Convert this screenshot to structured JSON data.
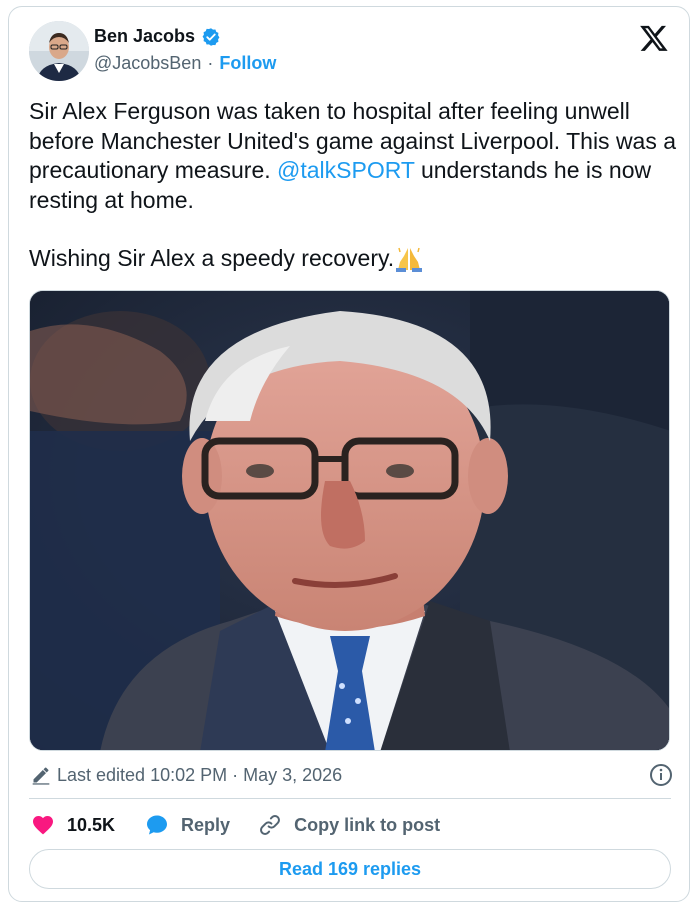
{
  "author": {
    "name": "Ben Jacobs",
    "handle": "@JacobsBen",
    "separator": "·",
    "follow_label": "Follow"
  },
  "post": {
    "text_before_mention": "Sir Alex Ferguson was taken to hospital after feeling unwell before Manchester United's game against Liverpool. This was a precautionary measure. ",
    "mention": "@talkSPORT",
    "text_after_mention": " understands he is now resting at home.",
    "second_paragraph": "Wishing Sir Alex a speedy recovery.",
    "emoji": "folded-hands"
  },
  "meta": {
    "edited_label": "Last edited 10:02 PM · May 3, 2026"
  },
  "actions": {
    "like_count": "10.5K",
    "reply_label": "Reply",
    "copy_label": "Copy link to post"
  },
  "read_replies_label": "Read 169 replies",
  "colors": {
    "accent": "#1d9bf0",
    "like": "#f91880",
    "text": "#0f1419",
    "muted": "#536471",
    "border": "#cfd9de"
  },
  "icons": [
    "verified-badge-icon",
    "x-logo-icon",
    "pencil-icon",
    "info-icon",
    "heart-icon",
    "reply-bubble-icon",
    "link-icon",
    "folded-hands-emoji"
  ]
}
